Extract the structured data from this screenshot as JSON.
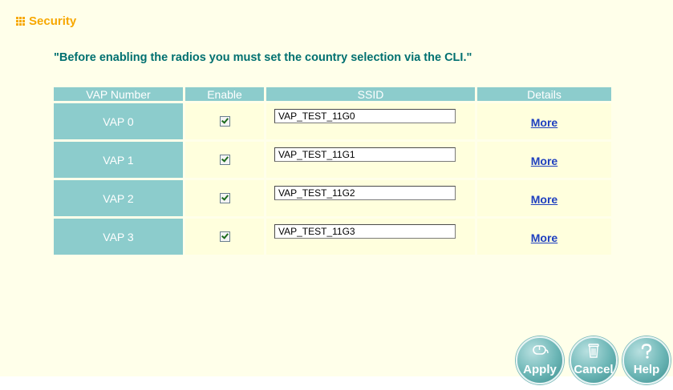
{
  "header": {
    "icon": "grid-icon",
    "title": "Security"
  },
  "notice": "\"Before enabling the radios you must set the country selection via the CLI.\"",
  "table": {
    "columns": [
      "VAP Number",
      "Enable",
      "SSID",
      "Details"
    ],
    "rows": [
      {
        "vap": "VAP 0",
        "enabled": true,
        "ssid": "VAP_TEST_11G0",
        "details": "More"
      },
      {
        "vap": "VAP 1",
        "enabled": true,
        "ssid": "VAP_TEST_11G1",
        "details": "More"
      },
      {
        "vap": "VAP 2",
        "enabled": true,
        "ssid": "VAP_TEST_11G2",
        "details": "More"
      },
      {
        "vap": "VAP 3",
        "enabled": true,
        "ssid": "VAP_TEST_11G3",
        "details": "More"
      }
    ]
  },
  "buttons": {
    "apply": {
      "label": "Apply",
      "icon": "mouse-icon"
    },
    "cancel": {
      "label": "Cancel",
      "icon": "trash-icon"
    },
    "help": {
      "label": "Help",
      "icon": "question-icon"
    }
  },
  "colors": {
    "header": "#f7a800",
    "notice": "#007070",
    "table_header": "#8ccccc",
    "cell_bg": "#ffffdd",
    "link": "#1e3fbf",
    "panel_bg": "#ffffea"
  }
}
